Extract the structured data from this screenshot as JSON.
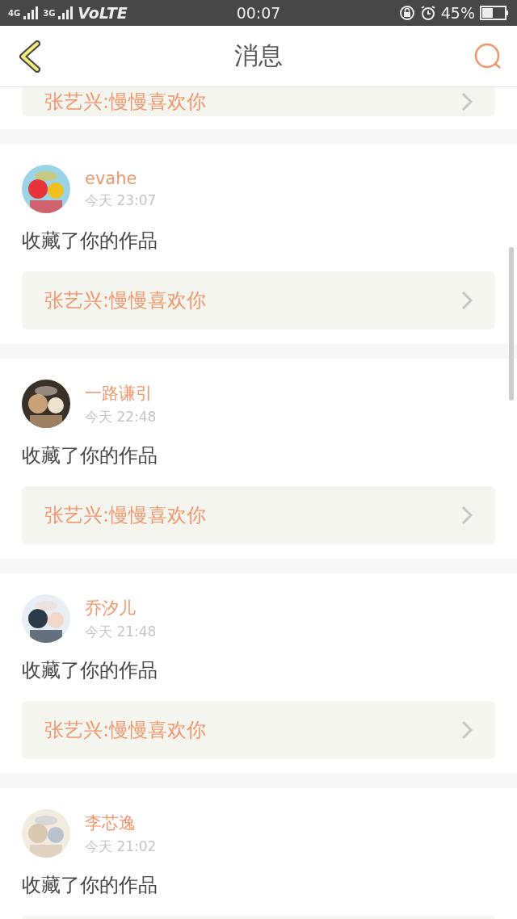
{
  "status_bar": {
    "network_1": "4G",
    "network_2": "3G",
    "volte": "VoLTE",
    "time": "00:07",
    "battery": "45%"
  },
  "header": {
    "title": "消息"
  },
  "top_link": {
    "text": "张艺兴:慢慢喜欢你"
  },
  "messages": [
    {
      "user": "evahe",
      "time": "今天 23:07",
      "action": "收藏了你的作品",
      "link": "张艺兴:慢慢喜欢你"
    },
    {
      "user": "一路谦引",
      "time": "今天 22:48",
      "action": "收藏了你的作品",
      "link": "张艺兴:慢慢喜欢你"
    },
    {
      "user": "乔汐儿",
      "time": "今天 21:48",
      "action": "收藏了你的作品",
      "link": "张艺兴:慢慢喜欢你"
    },
    {
      "user": "李芯逸",
      "time": "今天 21:02",
      "action": "收藏了你的作品"
    }
  ]
}
